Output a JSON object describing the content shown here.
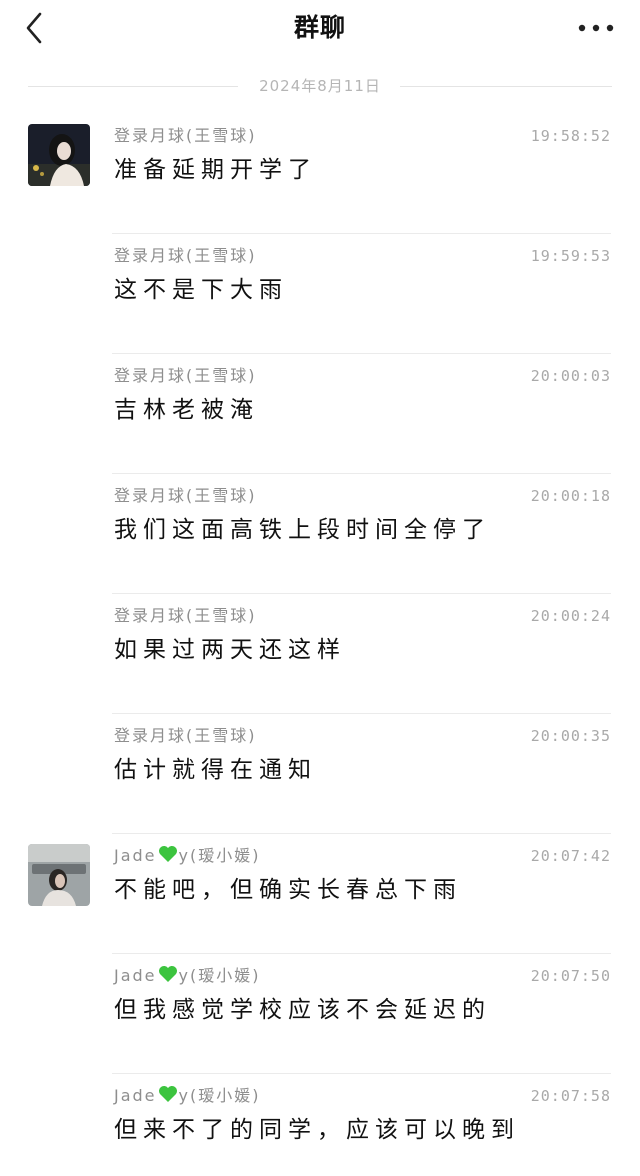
{
  "nav": {
    "title": "群聊",
    "back_icon": "chevron-left-icon",
    "more_icon": "more-dots-icon"
  },
  "date_divider": "2024年8月11日",
  "colors": {
    "heart": "#3cc43f",
    "avatar1_bg": "#1a1e2a",
    "avatar2_bg": "#9ea4a6"
  },
  "messages": [
    {
      "sender_prefix": "登录月球(王雪球)",
      "sender_suffix": "",
      "heart": false,
      "time": "19:58:52",
      "text": "准备延期开学了",
      "avatar": "avatar-1"
    },
    {
      "sender_prefix": "登录月球(王雪球)",
      "sender_suffix": "",
      "heart": false,
      "time": "19:59:53",
      "text": "这不是下大雨",
      "avatar": ""
    },
    {
      "sender_prefix": "登录月球(王雪球)",
      "sender_suffix": "",
      "heart": false,
      "time": "20:00:03",
      "text": "吉林老被淹",
      "avatar": ""
    },
    {
      "sender_prefix": "登录月球(王雪球)",
      "sender_suffix": "",
      "heart": false,
      "time": "20:00:18",
      "text": "我们这面高铁上段时间全停了",
      "avatar": ""
    },
    {
      "sender_prefix": "登录月球(王雪球)",
      "sender_suffix": "",
      "heart": false,
      "time": "20:00:24",
      "text": "如果过两天还这样",
      "avatar": ""
    },
    {
      "sender_prefix": "登录月球(王雪球)",
      "sender_suffix": "",
      "heart": false,
      "time": "20:00:35",
      "text": "估计就得在通知",
      "avatar": ""
    },
    {
      "sender_prefix": "Jade",
      "sender_suffix": "y(瑷小媛)",
      "heart": true,
      "time": "20:07:42",
      "text": "不能吧，但确实长春总下雨",
      "avatar": "avatar-2"
    },
    {
      "sender_prefix": "Jade",
      "sender_suffix": "y(瑷小媛)",
      "heart": true,
      "time": "20:07:50",
      "text": "但我感觉学校应该不会延迟的",
      "avatar": ""
    },
    {
      "sender_prefix": "Jade",
      "sender_suffix": "y(瑷小媛)",
      "heart": true,
      "time": "20:07:58",
      "text": "但来不了的同学，应该可以晚到",
      "avatar": ""
    }
  ]
}
